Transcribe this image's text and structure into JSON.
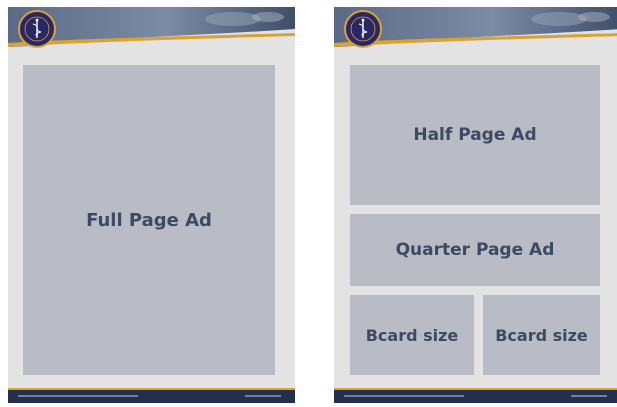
{
  "layouts": {
    "left": {
      "full_page_label": "Full Page Ad"
    },
    "right": {
      "half_page_label": "Half Page Ad",
      "quarter_page_label": "Quarter Page Ad",
      "bcard_left_label": "Bcard size",
      "bcard_right_label": "Bcard size"
    }
  },
  "colors": {
    "page_background": "#e3e3e3",
    "ad_block": "#b9bcc5",
    "ad_text": "#3d4a63",
    "header_navy": "#22304d",
    "accent_gold": "#d9a235",
    "logo_navy": "#2a2766"
  },
  "icons": {
    "logo": "caduceus-emblem-icon"
  }
}
